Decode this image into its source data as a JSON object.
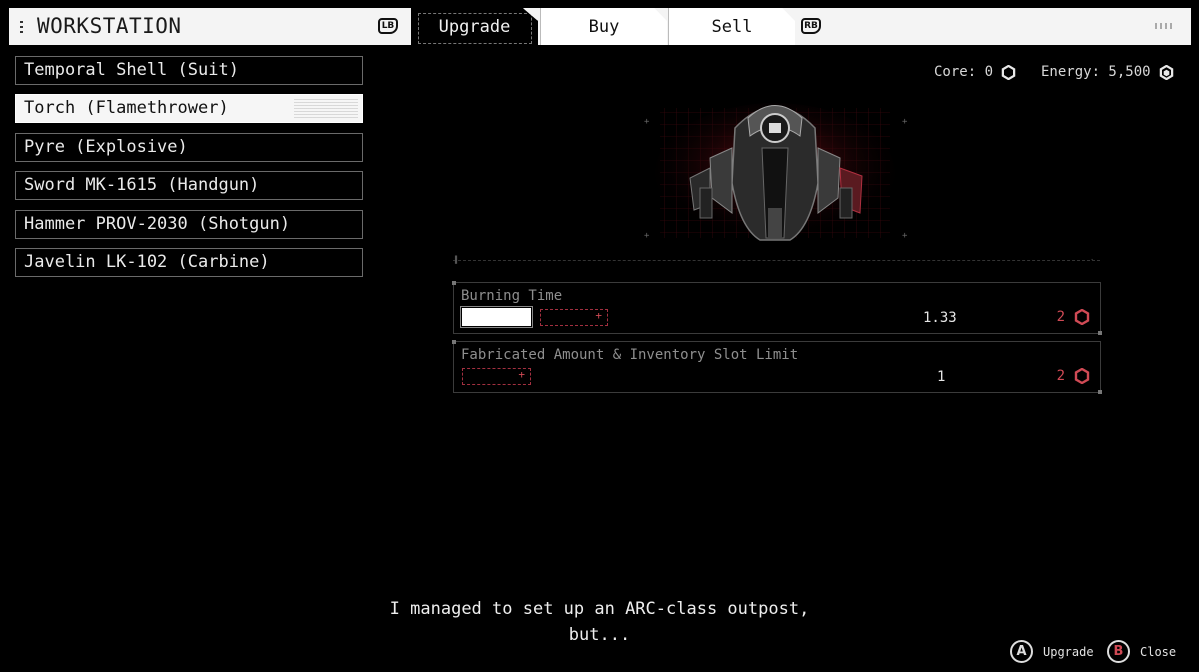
{
  "header": {
    "title": "WORKSTATION",
    "left_bumper": "LB",
    "right_bumper": "RB",
    "tabs": [
      {
        "label": "Upgrade",
        "active": true
      },
      {
        "label": "Buy",
        "active": false
      },
      {
        "label": "Sell",
        "active": false
      }
    ]
  },
  "items": [
    {
      "label": "Temporal Shell (Suit)"
    },
    {
      "label": "Torch (Flamethrower)",
      "selected": true
    },
    {
      "label": "Pyre (Explosive)"
    },
    {
      "label": "Sword MK-1615 (Handgun)"
    },
    {
      "label": "Hammer PROV-2030 (Shotgun)"
    },
    {
      "label": "Javelin LK-102 (Carbine)"
    }
  ],
  "resources": {
    "core_label": "Core: 0",
    "energy_label": "Energy: 5,500",
    "core_icon": "core-hex-icon",
    "energy_icon": "energy-hex-icon"
  },
  "stats": [
    {
      "label": "Burning Time",
      "value": "1.33",
      "cost": "2",
      "filled_segments": 1,
      "total_segments": 2
    },
    {
      "label": "Fabricated Amount & Inventory Slot Limit",
      "value": "1",
      "cost": "2",
      "filled_segments": 0,
      "total_segments": 1
    }
  ],
  "dialogue": {
    "line1": "I managed to set up an ARC-class outpost,",
    "line2": "but..."
  },
  "prompts": {
    "a_button": "A",
    "a_label": "Upgrade",
    "b_button": "B",
    "b_label": "Close"
  },
  "colors": {
    "accent_red": "#d04a55",
    "panel_white": "#f4f4f4",
    "background": "#000000"
  }
}
